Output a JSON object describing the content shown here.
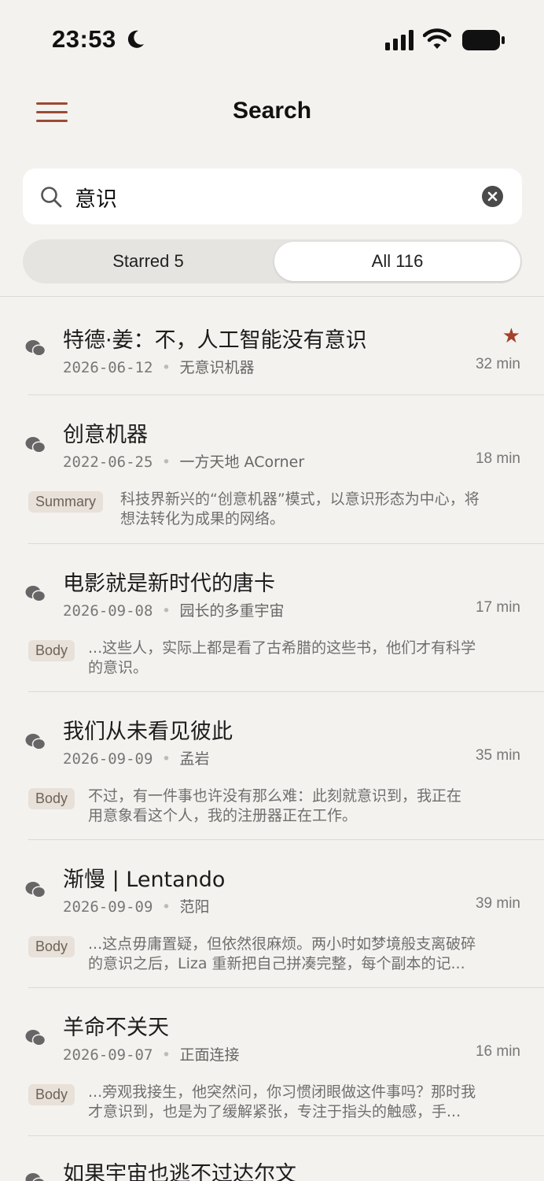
{
  "status_bar": {
    "time": "23:53"
  },
  "nav": {
    "title": "Search"
  },
  "search": {
    "query": "意识",
    "placeholder": ""
  },
  "segments": {
    "starred_label": "Starred 5",
    "all_label": "All 116",
    "selected": "all"
  },
  "colors": {
    "accent": "#9b4a34",
    "star": "#a3412b",
    "background": "#f4f2ef",
    "badge_bg": "#e7e1d9"
  },
  "results": [
    {
      "title": "特德·姜：不，人工智能没有意识",
      "date": "2026-06-12",
      "source": "无意识机器",
      "duration": "32 min",
      "starred": true,
      "icon": "wechat-icon"
    },
    {
      "title": "创意机器",
      "date": "2022-06-25",
      "source": "一方天地 ACorner",
      "duration": "18 min",
      "badge": "Summary",
      "snippet_line1": "科技界新兴的“创意机器”模式，以意识形态为中心，将",
      "snippet_line2": "想法转化为成果的网络。",
      "icon": "wechat-icon"
    },
    {
      "title": "电影就是新时代的唐卡",
      "date": "2026-09-08",
      "source": "园长的多重宇宙",
      "duration": "17 min",
      "badge": "Body",
      "snippet_line1": "...这些人，实际上都是看了古希腊的这些书，他们才有科学",
      "snippet_line2": "的意识。",
      "icon": "wechat-icon"
    },
    {
      "title": "我们从未看见彼此",
      "date": "2026-09-09",
      "source": "孟岩",
      "duration": "35 min",
      "badge": "Body",
      "snippet_line1": "不过，有一件事也许没有那么难：此刻就意识到，我正在",
      "snippet_line2": "用意象看这个人，我的注册器正在工作。",
      "icon": "wechat-icon"
    },
    {
      "title": "渐慢 | Lentando",
      "date": "2026-09-09",
      "source": "范阳",
      "duration": "39 min",
      "badge": "Body",
      "snippet_line1": "...这点毋庸置疑，但依然很麻烦。两小时如梦境般支离破碎",
      "snippet_line2": "的意识之后，Liza 重新把自己拼凑完整，每个副本的记...",
      "icon": "wechat-icon"
    },
    {
      "title": "羊命不关天",
      "date": "2026-09-07",
      "source": "正面连接",
      "duration": "16 min",
      "badge": "Body",
      "snippet_line1": "...旁观我接生，他突然问，你习惯闭眼做这件事吗？那时我",
      "snippet_line2": "才意识到，也是为了缓解紧张，专注于指头的触感，手...",
      "icon": "wechat-icon"
    },
    {
      "title": "如果宇宙也逃不过达尔文",
      "icon": "wechat-icon"
    }
  ],
  "meta_separator": "•"
}
